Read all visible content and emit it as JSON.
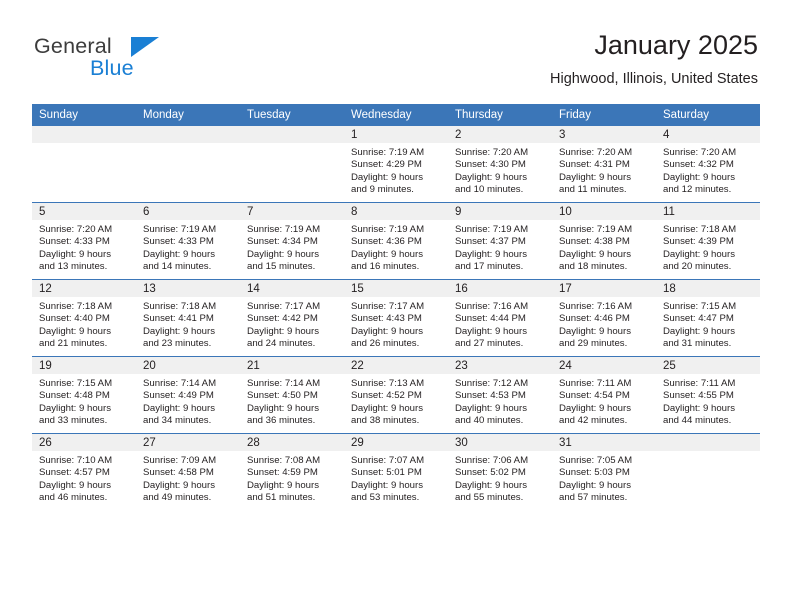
{
  "brand": {
    "name_part1": "General",
    "name_part2": "Blue",
    "flag_icon": "triangle-flag-icon"
  },
  "header": {
    "title": "January 2025",
    "location": "Highwood, Illinois, United States"
  },
  "colors": {
    "header_blue": "#3b76b8",
    "brand_blue": "#1a7fd4",
    "day_band": "#f0f0f0",
    "text": "#231f20"
  },
  "weekday_headers": [
    "Sunday",
    "Monday",
    "Tuesday",
    "Wednesday",
    "Thursday",
    "Friday",
    "Saturday"
  ],
  "weeks": [
    [
      {
        "day": "",
        "sunrise": "",
        "sunset": "",
        "daylight_line1": "",
        "daylight_line2": ""
      },
      {
        "day": "",
        "sunrise": "",
        "sunset": "",
        "daylight_line1": "",
        "daylight_line2": ""
      },
      {
        "day": "",
        "sunrise": "",
        "sunset": "",
        "daylight_line1": "",
        "daylight_line2": ""
      },
      {
        "day": "1",
        "sunrise": "Sunrise: 7:19 AM",
        "sunset": "Sunset: 4:29 PM",
        "daylight_line1": "Daylight: 9 hours",
        "daylight_line2": "and 9 minutes."
      },
      {
        "day": "2",
        "sunrise": "Sunrise: 7:20 AM",
        "sunset": "Sunset: 4:30 PM",
        "daylight_line1": "Daylight: 9 hours",
        "daylight_line2": "and 10 minutes."
      },
      {
        "day": "3",
        "sunrise": "Sunrise: 7:20 AM",
        "sunset": "Sunset: 4:31 PM",
        "daylight_line1": "Daylight: 9 hours",
        "daylight_line2": "and 11 minutes."
      },
      {
        "day": "4",
        "sunrise": "Sunrise: 7:20 AM",
        "sunset": "Sunset: 4:32 PM",
        "daylight_line1": "Daylight: 9 hours",
        "daylight_line2": "and 12 minutes."
      }
    ],
    [
      {
        "day": "5",
        "sunrise": "Sunrise: 7:20 AM",
        "sunset": "Sunset: 4:33 PM",
        "daylight_line1": "Daylight: 9 hours",
        "daylight_line2": "and 13 minutes."
      },
      {
        "day": "6",
        "sunrise": "Sunrise: 7:19 AM",
        "sunset": "Sunset: 4:33 PM",
        "daylight_line1": "Daylight: 9 hours",
        "daylight_line2": "and 14 minutes."
      },
      {
        "day": "7",
        "sunrise": "Sunrise: 7:19 AM",
        "sunset": "Sunset: 4:34 PM",
        "daylight_line1": "Daylight: 9 hours",
        "daylight_line2": "and 15 minutes."
      },
      {
        "day": "8",
        "sunrise": "Sunrise: 7:19 AM",
        "sunset": "Sunset: 4:36 PM",
        "daylight_line1": "Daylight: 9 hours",
        "daylight_line2": "and 16 minutes."
      },
      {
        "day": "9",
        "sunrise": "Sunrise: 7:19 AM",
        "sunset": "Sunset: 4:37 PM",
        "daylight_line1": "Daylight: 9 hours",
        "daylight_line2": "and 17 minutes."
      },
      {
        "day": "10",
        "sunrise": "Sunrise: 7:19 AM",
        "sunset": "Sunset: 4:38 PM",
        "daylight_line1": "Daylight: 9 hours",
        "daylight_line2": "and 18 minutes."
      },
      {
        "day": "11",
        "sunrise": "Sunrise: 7:18 AM",
        "sunset": "Sunset: 4:39 PM",
        "daylight_line1": "Daylight: 9 hours",
        "daylight_line2": "and 20 minutes."
      }
    ],
    [
      {
        "day": "12",
        "sunrise": "Sunrise: 7:18 AM",
        "sunset": "Sunset: 4:40 PM",
        "daylight_line1": "Daylight: 9 hours",
        "daylight_line2": "and 21 minutes."
      },
      {
        "day": "13",
        "sunrise": "Sunrise: 7:18 AM",
        "sunset": "Sunset: 4:41 PM",
        "daylight_line1": "Daylight: 9 hours",
        "daylight_line2": "and 23 minutes."
      },
      {
        "day": "14",
        "sunrise": "Sunrise: 7:17 AM",
        "sunset": "Sunset: 4:42 PM",
        "daylight_line1": "Daylight: 9 hours",
        "daylight_line2": "and 24 minutes."
      },
      {
        "day": "15",
        "sunrise": "Sunrise: 7:17 AM",
        "sunset": "Sunset: 4:43 PM",
        "daylight_line1": "Daylight: 9 hours",
        "daylight_line2": "and 26 minutes."
      },
      {
        "day": "16",
        "sunrise": "Sunrise: 7:16 AM",
        "sunset": "Sunset: 4:44 PM",
        "daylight_line1": "Daylight: 9 hours",
        "daylight_line2": "and 27 minutes."
      },
      {
        "day": "17",
        "sunrise": "Sunrise: 7:16 AM",
        "sunset": "Sunset: 4:46 PM",
        "daylight_line1": "Daylight: 9 hours",
        "daylight_line2": "and 29 minutes."
      },
      {
        "day": "18",
        "sunrise": "Sunrise: 7:15 AM",
        "sunset": "Sunset: 4:47 PM",
        "daylight_line1": "Daylight: 9 hours",
        "daylight_line2": "and 31 minutes."
      }
    ],
    [
      {
        "day": "19",
        "sunrise": "Sunrise: 7:15 AM",
        "sunset": "Sunset: 4:48 PM",
        "daylight_line1": "Daylight: 9 hours",
        "daylight_line2": "and 33 minutes."
      },
      {
        "day": "20",
        "sunrise": "Sunrise: 7:14 AM",
        "sunset": "Sunset: 4:49 PM",
        "daylight_line1": "Daylight: 9 hours",
        "daylight_line2": "and 34 minutes."
      },
      {
        "day": "21",
        "sunrise": "Sunrise: 7:14 AM",
        "sunset": "Sunset: 4:50 PM",
        "daylight_line1": "Daylight: 9 hours",
        "daylight_line2": "and 36 minutes."
      },
      {
        "day": "22",
        "sunrise": "Sunrise: 7:13 AM",
        "sunset": "Sunset: 4:52 PM",
        "daylight_line1": "Daylight: 9 hours",
        "daylight_line2": "and 38 minutes."
      },
      {
        "day": "23",
        "sunrise": "Sunrise: 7:12 AM",
        "sunset": "Sunset: 4:53 PM",
        "daylight_line1": "Daylight: 9 hours",
        "daylight_line2": "and 40 minutes."
      },
      {
        "day": "24",
        "sunrise": "Sunrise: 7:11 AM",
        "sunset": "Sunset: 4:54 PM",
        "daylight_line1": "Daylight: 9 hours",
        "daylight_line2": "and 42 minutes."
      },
      {
        "day": "25",
        "sunrise": "Sunrise: 7:11 AM",
        "sunset": "Sunset: 4:55 PM",
        "daylight_line1": "Daylight: 9 hours",
        "daylight_line2": "and 44 minutes."
      }
    ],
    [
      {
        "day": "26",
        "sunrise": "Sunrise: 7:10 AM",
        "sunset": "Sunset: 4:57 PM",
        "daylight_line1": "Daylight: 9 hours",
        "daylight_line2": "and 46 minutes."
      },
      {
        "day": "27",
        "sunrise": "Sunrise: 7:09 AM",
        "sunset": "Sunset: 4:58 PM",
        "daylight_line1": "Daylight: 9 hours",
        "daylight_line2": "and 49 minutes."
      },
      {
        "day": "28",
        "sunrise": "Sunrise: 7:08 AM",
        "sunset": "Sunset: 4:59 PM",
        "daylight_line1": "Daylight: 9 hours",
        "daylight_line2": "and 51 minutes."
      },
      {
        "day": "29",
        "sunrise": "Sunrise: 7:07 AM",
        "sunset": "Sunset: 5:01 PM",
        "daylight_line1": "Daylight: 9 hours",
        "daylight_line2": "and 53 minutes."
      },
      {
        "day": "30",
        "sunrise": "Sunrise: 7:06 AM",
        "sunset": "Sunset: 5:02 PM",
        "daylight_line1": "Daylight: 9 hours",
        "daylight_line2": "and 55 minutes."
      },
      {
        "day": "31",
        "sunrise": "Sunrise: 7:05 AM",
        "sunset": "Sunset: 5:03 PM",
        "daylight_line1": "Daylight: 9 hours",
        "daylight_line2": "and 57 minutes."
      },
      {
        "day": "",
        "sunrise": "",
        "sunset": "",
        "daylight_line1": "",
        "daylight_line2": ""
      }
    ]
  ]
}
